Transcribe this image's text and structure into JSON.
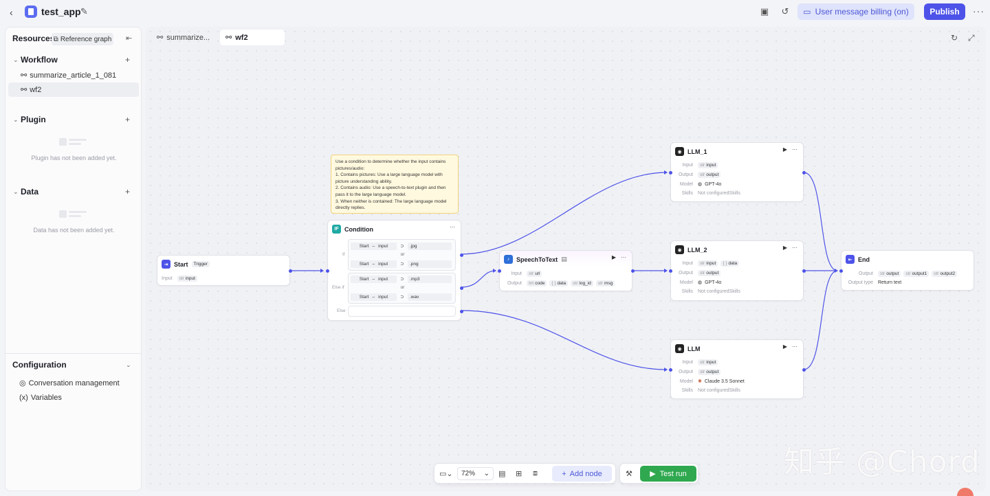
{
  "header": {
    "back_glyph": "‹",
    "app_title": "test_app",
    "billing_label": "User message billing (on)",
    "publish_label": "Publish",
    "more_glyph": "···"
  },
  "sidebar": {
    "resources_label": "Resources",
    "reference_graph_label": "Reference graph",
    "workflow": {
      "title": "Workflow",
      "items": [
        {
          "label": "summarize_article_1_081",
          "active": false
        },
        {
          "label": "wf2",
          "active": true
        }
      ]
    },
    "plugin": {
      "title": "Plugin",
      "empty_text": "Plugin has not been added yet."
    },
    "data": {
      "title": "Data",
      "empty_text": "Data has not been added yet."
    },
    "configuration": {
      "title": "Configuration",
      "items": [
        "Conversation management",
        "Variables"
      ]
    }
  },
  "tabs": [
    {
      "label": "summarize...",
      "active": false
    },
    {
      "label": "wf2",
      "active": true
    }
  ],
  "note": {
    "text": "Use a condition to determine whether the input contains pictures/audio:\n1. Contains pictures: Use a large language model with picture understanding ability.\n2. Contains audio: Use a speech-to-text plugin and then pass it to the large language model.\n3. When neither is contained: The large language model directly replies."
  },
  "nodes": {
    "start": {
      "title": "Start",
      "badge": "Trigger",
      "input_label": "Input",
      "input_type": "str",
      "input_name": "input"
    },
    "condition": {
      "title": "Condition",
      "icon_text": "IF",
      "if_label": "If",
      "elseif_label": "Else if",
      "else_label": "Else",
      "or_label": "or",
      "operator": "⊃",
      "left_node": "Start",
      "left_var": "input",
      "if_values": [
        ".jpg",
        ".png"
      ],
      "elseif_values": [
        ".mp3",
        ".wav"
      ]
    },
    "speech": {
      "title": "SpeechToText",
      "input_label": "Input",
      "input": {
        "type": "str",
        "name": "url"
      },
      "output_label": "Output",
      "outputs": [
        {
          "type": "Int",
          "name": "code"
        },
        {
          "type": "{ }",
          "name": "data"
        },
        {
          "type": "str",
          "name": "log_id"
        },
        {
          "type": "str",
          "name": "msg"
        }
      ]
    },
    "llm1": {
      "title": "LLM_1",
      "input_label": "Input",
      "inputs": [
        {
          "type": "str",
          "name": "input"
        }
      ],
      "output_label": "Output",
      "output": {
        "type": "str",
        "name": "output"
      },
      "model_label": "Model",
      "model": "GPT-4o",
      "skills_label": "Skills",
      "skills": "Not configuredSkills"
    },
    "llm2": {
      "title": "LLM_2",
      "input_label": "Input",
      "inputs": [
        {
          "type": "str",
          "name": "input"
        },
        {
          "type": "{ }",
          "name": "data"
        }
      ],
      "output_label": "Output",
      "output": {
        "type": "str",
        "name": "output"
      },
      "model_label": "Model",
      "model": "GPT-4o",
      "skills_label": "Skills",
      "skills": "Not configuredSkills"
    },
    "llm3": {
      "title": "LLM",
      "input_label": "Input",
      "inputs": [
        {
          "type": "str",
          "name": "input"
        }
      ],
      "output_label": "Output",
      "output": {
        "type": "str",
        "name": "output"
      },
      "model_label": "Model",
      "model": "Claude 3.5 Sonnet",
      "skills_label": "Skills",
      "skills": "Not configuredSkills"
    },
    "end": {
      "title": "End",
      "output_label": "Output",
      "outputs": [
        {
          "type": "str",
          "name": "output"
        },
        {
          "type": "str",
          "name": "output1"
        },
        {
          "type": "str",
          "name": "output2"
        }
      ],
      "output_type_label": "Output type",
      "output_type": "Return text"
    }
  },
  "toolbar": {
    "zoom": "72%",
    "add_node_label": "Add node",
    "test_run_label": "Test run"
  },
  "watermark": "知乎 @Chord",
  "colors": {
    "accent": "#4d53e8",
    "billing_bg": "#dfe3fb",
    "test_run": "#2fa84f",
    "note_bg": "#fff9df",
    "edge": "#4d53e8"
  }
}
